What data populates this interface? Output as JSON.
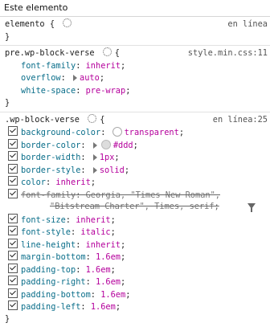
{
  "header": {
    "title": "Este elemento"
  },
  "rules": [
    {
      "selector": "elemento",
      "source": "en línea",
      "open": "{",
      "close": "}"
    },
    {
      "selector": "pre.wp-block-verse",
      "source": "style.min.css:11",
      "open": "{",
      "close": "}",
      "props": [
        {
          "name": "font-family",
          "value": "inherit"
        },
        {
          "name": "overflow",
          "value": "auto"
        },
        {
          "name": "white-space",
          "value": "pre-wrap"
        }
      ]
    },
    {
      "selector": ".wp-block-verse",
      "source": "en línea:25",
      "open": "{",
      "close": "}",
      "props": [
        {
          "name": "background-color",
          "value": "transparent"
        },
        {
          "name": "border-color",
          "value": "#ddd"
        },
        {
          "name": "border-width",
          "value": "1px"
        },
        {
          "name": "border-style",
          "value": "solid"
        },
        {
          "name": "color",
          "value": "inherit"
        },
        {
          "name": "font-family",
          "value": "Georgia, \"Times New Roman\",",
          "value2": "\"Bitstream Charter\", Times, serif"
        },
        {
          "name": "font-size",
          "value": "inherit"
        },
        {
          "name": "font-style",
          "value": "italic"
        },
        {
          "name": "line-height",
          "value": "inherit"
        },
        {
          "name": "margin-bottom",
          "value": "1.6em"
        },
        {
          "name": "padding-top",
          "value": "1.6em"
        },
        {
          "name": "padding-right",
          "value": "1.6em"
        },
        {
          "name": "padding-bottom",
          "value": "1.6em"
        },
        {
          "name": "padding-left",
          "value": "1.6em"
        }
      ]
    }
  ],
  "colors": {
    "border_color_swatch": "#ddd",
    "bg_swatch": "transparent"
  }
}
